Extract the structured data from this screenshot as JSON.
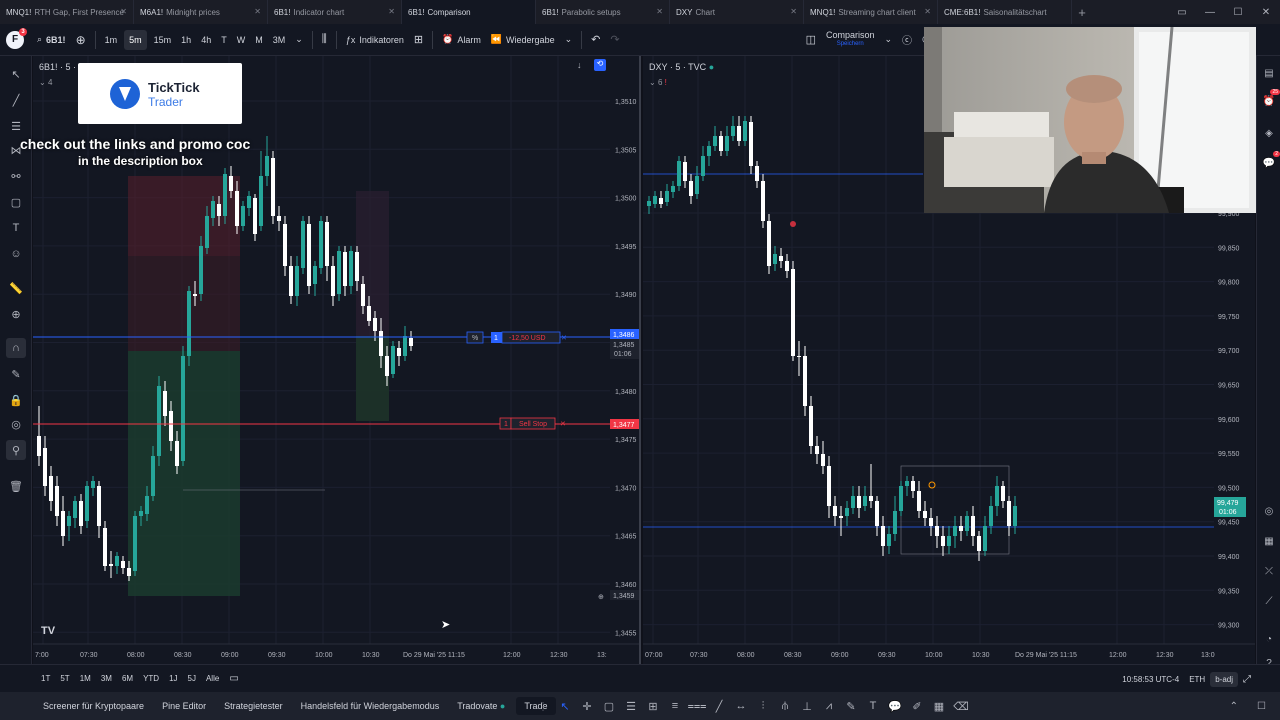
{
  "tabs": [
    {
      "symbol": "MNQ1!",
      "label": "RTH Gap, First Presence"
    },
    {
      "symbol": "M6A1!",
      "label": "Midnight prices"
    },
    {
      "symbol": "6B1!",
      "label": "Indicator chart"
    },
    {
      "symbol": "6B1!",
      "label": "Comparison"
    },
    {
      "symbol": "6B1!",
      "label": "Parabolic setups"
    },
    {
      "symbol": "DXY",
      "label": "Chart"
    },
    {
      "symbol": "MNQ1!",
      "label": "Streaming chart client"
    },
    {
      "symbol": "CME:6B1!",
      "label": "Saisonalitätschart"
    }
  ],
  "active_tab": 3,
  "toolbar": {
    "logo": "F",
    "logo_badge": "3",
    "symbol": "6B1!",
    "intervals": [
      "1m",
      "5m",
      "15m",
      "1h",
      "4h",
      "T",
      "W",
      "M",
      "3M"
    ],
    "active_interval": "5m",
    "indicators": "Indikatoren",
    "alarm": "Alarm",
    "replay": "Wiedergabe",
    "layout_name": "Comparison",
    "layout_sub": "Speichern"
  },
  "left_pane": {
    "title": "6B1! · 5 · CME",
    "sub": "4",
    "price_labels": [
      "1,3510",
      "1,3505",
      "1,3500",
      "1,3495",
      "1,3490",
      "1,3485",
      "1,3480",
      "1,3475",
      "1,3470",
      "1,3465",
      "1,3460",
      "1,3455"
    ],
    "time_labels": [
      "7:00",
      "07:30",
      "08:00",
      "08:30",
      "09:00",
      "09:30",
      "10:00",
      "10:30",
      "Do 29 Mai '25  11:15",
      "12:00",
      "12:30",
      "13:"
    ],
    "current_price": "1,3486",
    "current_price2": "1,3485",
    "countdown": "01:06",
    "stop_price": "1,3477",
    "low_label": "1,3459",
    "order_qty": "1",
    "order_pnl": "-12,50 USD",
    "order_pct": "%",
    "sell_stop_qty": "1",
    "sell_stop_label": "Sell Stop"
  },
  "right_pane": {
    "title": "DXY · 5 · TVC",
    "sub": "6",
    "price_labels": [
      "99,900",
      "99,850",
      "99,800",
      "99,750",
      "99,700",
      "99,650",
      "99,600",
      "99,550",
      "99,500",
      "99,450",
      "99,400",
      "99,350",
      "99,300"
    ],
    "time_labels": [
      "07:00",
      "07:30",
      "08:00",
      "08:30",
      "09:00",
      "09:30",
      "10:00",
      "10:30",
      "Do 29 Mai '25  11:15",
      "12:00",
      "12:30",
      "13:0"
    ],
    "current_price": "99,479",
    "countdown": "01:06"
  },
  "bottombar": {
    "ranges": [
      "1T",
      "5T",
      "1M",
      "3M",
      "6M",
      "YTD",
      "1J",
      "5J",
      "Alle"
    ],
    "clock": "10:58:53 UTC-4",
    "session": "ETH",
    "adj": "b-adj"
  },
  "footer": {
    "items": [
      "Screener für Kryptopaare",
      "Pine Editor",
      "Strategietester",
      "Handelsfeld für Wiedergabemodus",
      "Tradovate"
    ],
    "trade": "Trade"
  },
  "promo": {
    "brand": "TickTick",
    "brand_sub": "Trader",
    "line1": "check out the links and promo coc",
    "line2": "in the description box"
  },
  "colors": {
    "up": "#26a69a",
    "down": "#ffffff",
    "accent": "#2962ff",
    "sell": "#f23645",
    "background": "#131722"
  }
}
